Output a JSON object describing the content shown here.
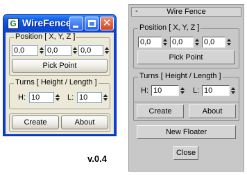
{
  "xp_window": {
    "title": "WireFence",
    "app_icon": "G",
    "position_group_label": "Position [ X, Y, Z ]",
    "x_value": "0,0",
    "y_value": "0,0",
    "z_value": "0,0",
    "pick_point_label": "Pick Point",
    "turns_group_label": "Turns [ Height / Length ]",
    "height_label": "H:",
    "height_value": "10",
    "length_label": "L:",
    "length_value": "10",
    "create_label": "Create",
    "about_label": "About"
  },
  "version_label": "v.0.4",
  "max_panel": {
    "collapse_glyph": "-",
    "title": "Wire Fence",
    "position_group_label": "Position [ X, Y, Z ]",
    "x_value": "0,0",
    "y_value": "0,0",
    "z_value": "0,0",
    "pick_point_label": "Pick Point",
    "turns_group_label": "Turns [ Height / Length ]",
    "height_label": "H:",
    "height_value": "10",
    "length_label": "L:",
    "length_value": "10",
    "create_label": "Create",
    "about_label": "About",
    "new_floater_label": "New Floater",
    "close_label": "Close"
  },
  "colors": {
    "xp_titlebar": "#0f5ee8",
    "xp_client": "#ece9d8",
    "max_panel": "#c8c8c8"
  }
}
